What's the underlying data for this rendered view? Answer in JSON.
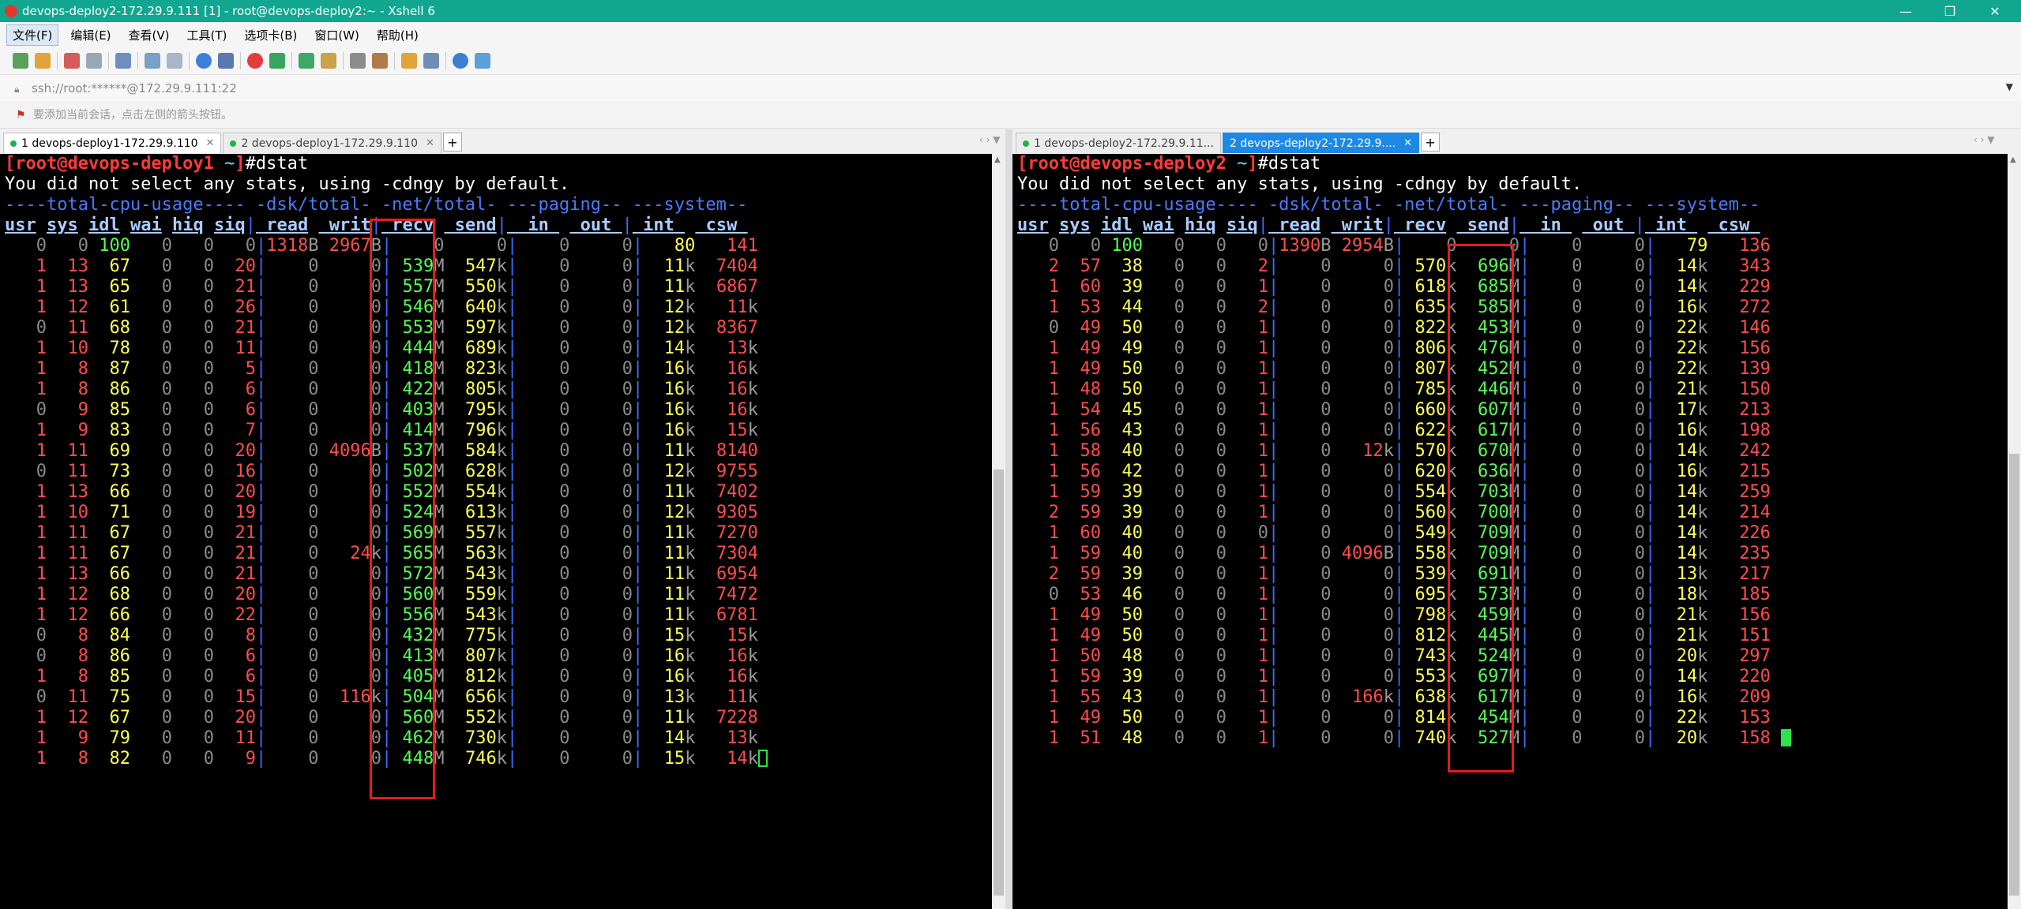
{
  "window": {
    "title": "devops-deploy2-172.29.9.111 [1] - root@devops-deploy2:~ - Xshell 6",
    "minimize_glyph": "—",
    "maximize_glyph": "❐",
    "close_glyph": "✕"
  },
  "menu": [
    {
      "label": "文件(F)"
    },
    {
      "label": "编辑(E)"
    },
    {
      "label": "查看(V)"
    },
    {
      "label": "工具(T)"
    },
    {
      "label": "选项卡(B)"
    },
    {
      "label": "窗口(W)"
    },
    {
      "label": "帮助(H)"
    }
  ],
  "address": {
    "value": "ssh://root:******@172.29.9.111:22"
  },
  "hint": {
    "text": "要添加当前会话，点击左侧的箭头按钮。"
  },
  "colors": {
    "accent": "#11a68f",
    "tab_active": "#1e88e5",
    "highlight_box": "#e21d1d",
    "terminal_bg": "#000000"
  },
  "left": {
    "tabs": [
      {
        "label": "1 devops-deploy1-172.29.9.110",
        "state": "active-white"
      },
      {
        "label": "2 devops-deploy1-172.29.9.110",
        "state": "inactive"
      }
    ],
    "prompt_user": "root@devops-deploy1",
    "prompt_dir": "~",
    "command": "#dstat",
    "message": "You did not select any stats, using -cdngy by default.",
    "highlighted_column": "recv",
    "rows": [
      [
        "0",
        "0",
        "100",
        "0",
        "0",
        "0",
        "1318B",
        "2967B",
        "0",
        "0",
        "0",
        "0",
        "80",
        "141"
      ],
      [
        "1",
        "13",
        "67",
        "0",
        "0",
        "20",
        "0",
        "0",
        "539M",
        "547k",
        "0",
        "0",
        "11k",
        "7404"
      ],
      [
        "1",
        "13",
        "65",
        "0",
        "0",
        "21",
        "0",
        "0",
        "557M",
        "550k",
        "0",
        "0",
        "11k",
        "6867"
      ],
      [
        "1",
        "12",
        "61",
        "0",
        "0",
        "26",
        "0",
        "0",
        "546M",
        "640k",
        "0",
        "0",
        "12k",
        "11k"
      ],
      [
        "0",
        "11",
        "68",
        "0",
        "0",
        "21",
        "0",
        "0",
        "553M",
        "597k",
        "0",
        "0",
        "12k",
        "8367"
      ],
      [
        "1",
        "10",
        "78",
        "0",
        "0",
        "11",
        "0",
        "0",
        "444M",
        "689k",
        "0",
        "0",
        "14k",
        "13k"
      ],
      [
        "1",
        "8",
        "87",
        "0",
        "0",
        "5",
        "0",
        "0",
        "418M",
        "823k",
        "0",
        "0",
        "16k",
        "16k"
      ],
      [
        "1",
        "8",
        "86",
        "0",
        "0",
        "6",
        "0",
        "0",
        "422M",
        "805k",
        "0",
        "0",
        "16k",
        "16k"
      ],
      [
        "0",
        "9",
        "85",
        "0",
        "0",
        "6",
        "0",
        "0",
        "403M",
        "795k",
        "0",
        "0",
        "16k",
        "16k"
      ],
      [
        "1",
        "9",
        "83",
        "0",
        "0",
        "7",
        "0",
        "0",
        "414M",
        "796k",
        "0",
        "0",
        "16k",
        "15k"
      ],
      [
        "1",
        "11",
        "69",
        "0",
        "0",
        "20",
        "0",
        "4096B",
        "537M",
        "584k",
        "0",
        "0",
        "11k",
        "8140"
      ],
      [
        "0",
        "11",
        "73",
        "0",
        "0",
        "16",
        "0",
        "0",
        "502M",
        "628k",
        "0",
        "0",
        "12k",
        "9755"
      ],
      [
        "1",
        "13",
        "66",
        "0",
        "0",
        "20",
        "0",
        "0",
        "552M",
        "554k",
        "0",
        "0",
        "11k",
        "7402"
      ],
      [
        "1",
        "10",
        "71",
        "0",
        "0",
        "19",
        "0",
        "0",
        "524M",
        "613k",
        "0",
        "0",
        "12k",
        "9305"
      ],
      [
        "1",
        "11",
        "67",
        "0",
        "0",
        "21",
        "0",
        "0",
        "569M",
        "557k",
        "0",
        "0",
        "11k",
        "7270"
      ],
      [
        "1",
        "11",
        "67",
        "0",
        "0",
        "21",
        "0",
        "24k",
        "565M",
        "563k",
        "0",
        "0",
        "11k",
        "7304"
      ],
      [
        "1",
        "13",
        "66",
        "0",
        "0",
        "21",
        "0",
        "0",
        "572M",
        "543k",
        "0",
        "0",
        "11k",
        "6954"
      ],
      [
        "1",
        "12",
        "68",
        "0",
        "0",
        "20",
        "0",
        "0",
        "560M",
        "559k",
        "0",
        "0",
        "11k",
        "7472"
      ],
      [
        "1",
        "12",
        "66",
        "0",
        "0",
        "22",
        "0",
        "0",
        "556M",
        "543k",
        "0",
        "0",
        "11k",
        "6781"
      ],
      [
        "0",
        "8",
        "84",
        "0",
        "0",
        "8",
        "0",
        "0",
        "432M",
        "775k",
        "0",
        "0",
        "15k",
        "15k"
      ],
      [
        "0",
        "8",
        "86",
        "0",
        "0",
        "6",
        "0",
        "0",
        "413M",
        "807k",
        "0",
        "0",
        "16k",
        "16k"
      ],
      [
        "1",
        "8",
        "85",
        "0",
        "0",
        "6",
        "0",
        "0",
        "405M",
        "812k",
        "0",
        "0",
        "16k",
        "16k"
      ],
      [
        "0",
        "11",
        "75",
        "0",
        "0",
        "15",
        "0",
        "116k",
        "504M",
        "656k",
        "0",
        "0",
        "13k",
        "11k"
      ],
      [
        "1",
        "12",
        "67",
        "0",
        "0",
        "20",
        "0",
        "0",
        "560M",
        "552k",
        "0",
        "0",
        "11k",
        "7228"
      ],
      [
        "1",
        "9",
        "79",
        "0",
        "0",
        "11",
        "0",
        "0",
        "462M",
        "730k",
        "0",
        "0",
        "14k",
        "13k"
      ],
      [
        "1",
        "8",
        "82",
        "0",
        "0",
        "9",
        "0",
        "0",
        "448M",
        "746k",
        "0",
        "0",
        "15k",
        "14k"
      ]
    ]
  },
  "right": {
    "tabs": [
      {
        "label": "1 devops-deploy2-172.29.9.11...",
        "state": "inactive"
      },
      {
        "label": "2 devops-deploy2-172.29.9....",
        "state": "active"
      }
    ],
    "prompt_user": "root@devops-deploy2",
    "prompt_dir": "~",
    "command": "#dstat",
    "message": "You did not select any stats, using -cdngy by default.",
    "highlighted_column": "send",
    "rows": [
      [
        "0",
        "0",
        "100",
        "0",
        "0",
        "0",
        "1390B",
        "2954B",
        "0",
        "0",
        "0",
        "0",
        "79",
        "136"
      ],
      [
        "2",
        "57",
        "38",
        "0",
        "0",
        "2",
        "0",
        "0",
        "570k",
        "696M",
        "0",
        "0",
        "14k",
        "343"
      ],
      [
        "1",
        "60",
        "39",
        "0",
        "0",
        "1",
        "0",
        "0",
        "618k",
        "685M",
        "0",
        "0",
        "14k",
        "229"
      ],
      [
        "1",
        "53",
        "44",
        "0",
        "0",
        "2",
        "0",
        "0",
        "635k",
        "585M",
        "0",
        "0",
        "16k",
        "272"
      ],
      [
        "0",
        "49",
        "50",
        "0",
        "0",
        "1",
        "0",
        "0",
        "822k",
        "453M",
        "0",
        "0",
        "22k",
        "146"
      ],
      [
        "1",
        "49",
        "49",
        "0",
        "0",
        "1",
        "0",
        "0",
        "806k",
        "476M",
        "0",
        "0",
        "22k",
        "156"
      ],
      [
        "1",
        "49",
        "50",
        "0",
        "0",
        "1",
        "0",
        "0",
        "807k",
        "452M",
        "0",
        "0",
        "22k",
        "139"
      ],
      [
        "1",
        "48",
        "50",
        "0",
        "0",
        "1",
        "0",
        "0",
        "785k",
        "446M",
        "0",
        "0",
        "21k",
        "150"
      ],
      [
        "1",
        "54",
        "45",
        "0",
        "0",
        "1",
        "0",
        "0",
        "660k",
        "607M",
        "0",
        "0",
        "17k",
        "213"
      ],
      [
        "1",
        "56",
        "43",
        "0",
        "0",
        "1",
        "0",
        "0",
        "622k",
        "617M",
        "0",
        "0",
        "16k",
        "198"
      ],
      [
        "1",
        "58",
        "40",
        "0",
        "0",
        "1",
        "0",
        "12k",
        "570k",
        "670M",
        "0",
        "0",
        "14k",
        "242"
      ],
      [
        "1",
        "56",
        "42",
        "0",
        "0",
        "1",
        "0",
        "0",
        "620k",
        "636M",
        "0",
        "0",
        "16k",
        "215"
      ],
      [
        "1",
        "59",
        "39",
        "0",
        "0",
        "1",
        "0",
        "0",
        "554k",
        "703M",
        "0",
        "0",
        "14k",
        "259"
      ],
      [
        "2",
        "59",
        "39",
        "0",
        "0",
        "1",
        "0",
        "0",
        "560k",
        "700M",
        "0",
        "0",
        "14k",
        "214"
      ],
      [
        "1",
        "60",
        "40",
        "0",
        "0",
        "0",
        "0",
        "0",
        "549k",
        "709M",
        "0",
        "0",
        "14k",
        "226"
      ],
      [
        "1",
        "59",
        "40",
        "0",
        "0",
        "1",
        "0",
        "4096B",
        "558k",
        "709M",
        "0",
        "0",
        "14k",
        "235"
      ],
      [
        "2",
        "59",
        "39",
        "0",
        "0",
        "1",
        "0",
        "0",
        "539k",
        "691M",
        "0",
        "0",
        "13k",
        "217"
      ],
      [
        "0",
        "53",
        "46",
        "0",
        "0",
        "1",
        "0",
        "0",
        "695k",
        "573M",
        "0",
        "0",
        "18k",
        "185"
      ],
      [
        "1",
        "49",
        "50",
        "0",
        "0",
        "1",
        "0",
        "0",
        "798k",
        "459M",
        "0",
        "0",
        "21k",
        "156"
      ],
      [
        "1",
        "49",
        "50",
        "0",
        "0",
        "1",
        "0",
        "0",
        "812k",
        "445M",
        "0",
        "0",
        "21k",
        "151"
      ],
      [
        "1",
        "50",
        "48",
        "0",
        "0",
        "1",
        "0",
        "0",
        "743k",
        "524M",
        "0",
        "0",
        "20k",
        "297"
      ],
      [
        "1",
        "59",
        "39",
        "0",
        "0",
        "1",
        "0",
        "0",
        "553k",
        "697M",
        "0",
        "0",
        "14k",
        "220"
      ],
      [
        "1",
        "55",
        "43",
        "0",
        "0",
        "1",
        "0",
        "166k",
        "638k",
        "617M",
        "0",
        "0",
        "16k",
        "209"
      ],
      [
        "1",
        "49",
        "50",
        "0",
        "0",
        "1",
        "0",
        "0",
        "814k",
        "454M",
        "0",
        "0",
        "22k",
        "153"
      ],
      [
        "1",
        "51",
        "48",
        "0",
        "0",
        "1",
        "0",
        "0",
        "740k",
        "527M",
        "0",
        "0",
        "20k",
        "158"
      ]
    ]
  }
}
